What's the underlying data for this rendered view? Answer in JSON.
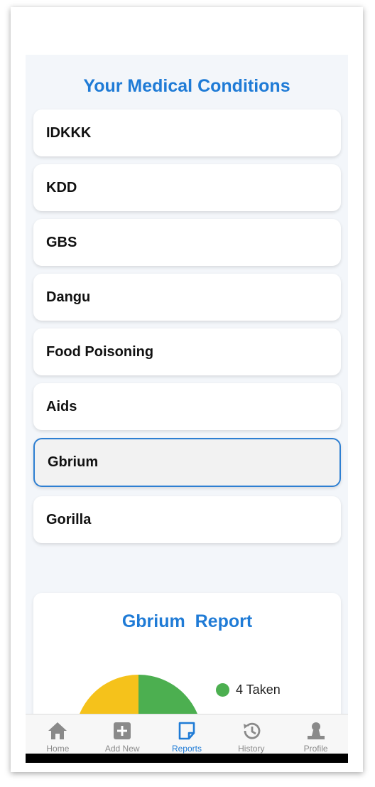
{
  "screen_title": "Your Medical Conditions",
  "conditions": [
    {
      "name": "IDKKK"
    },
    {
      "name": "KDD"
    },
    {
      "name": "GBS"
    },
    {
      "name": "Dangu"
    },
    {
      "name": "Food Poisoning"
    },
    {
      "name": "Aids"
    },
    {
      "name": "Gbrium"
    },
    {
      "name": "Gorilla"
    }
  ],
  "selected_condition": "Gbrium",
  "report": {
    "title": "Gbrium  Report",
    "legend": [
      {
        "label": "4 Taken",
        "color": "#4caf50"
      }
    ],
    "colors": {
      "taken": "#4caf50",
      "other": "#f5c21b"
    }
  },
  "tabs": [
    {
      "label": "Home",
      "icon": "home-icon"
    },
    {
      "label": "Add New",
      "icon": "add-icon"
    },
    {
      "label": "Reports",
      "icon": "reports-icon",
      "active": true
    },
    {
      "label": "History",
      "icon": "history-icon"
    },
    {
      "label": "Profile",
      "icon": "profile-icon"
    }
  ],
  "accent_color": "#1f7bd6"
}
